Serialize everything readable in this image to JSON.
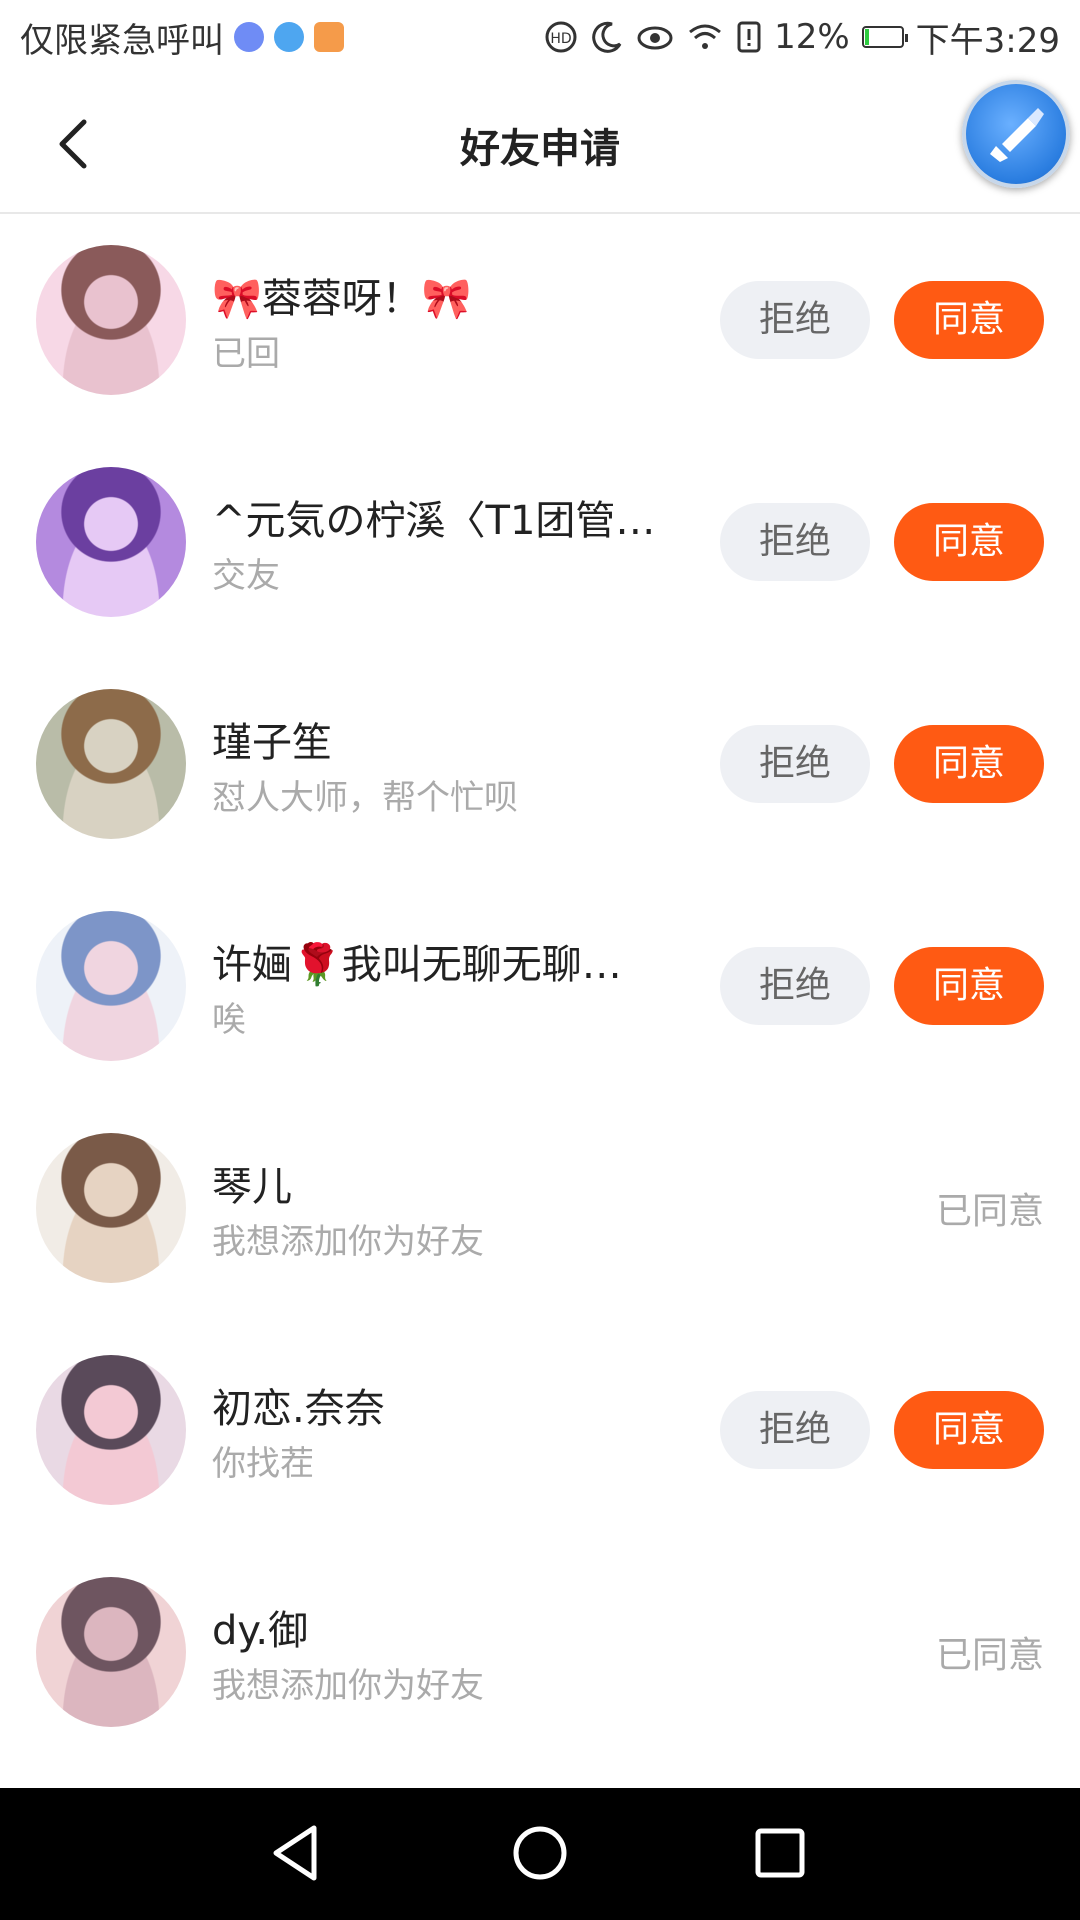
{
  "status_bar": {
    "carrier": "仅限紧急呼叫",
    "battery_pct": "12%",
    "battery_level": 0.12,
    "time": "下午3:29"
  },
  "header": {
    "title": "好友申请"
  },
  "colors": {
    "accent": "#ff5a13",
    "reject_bg": "#eef0f4",
    "muted_text": "#aaaaaa"
  },
  "requests": [
    {
      "name": "🎀蓉蓉呀！🎀",
      "message": "已回",
      "state": "pending",
      "reject_label": "拒绝",
      "agree_label": "同意",
      "avatar_colors": [
        "#f7d8e6",
        "#8a5a5a",
        "#e9c2cf"
      ]
    },
    {
      "name": "^元気の柠溪〈T1团管…",
      "message": "交友",
      "state": "pending",
      "reject_label": "拒绝",
      "agree_label": "同意",
      "avatar_colors": [
        "#b48adf",
        "#6b3fa0",
        "#e6c9f5"
      ]
    },
    {
      "name": "瑾子笙",
      "message": "怼人大师，帮个忙呗",
      "state": "pending",
      "reject_label": "拒绝",
      "agree_label": "同意",
      "avatar_colors": [
        "#b9bca8",
        "#8d6b4a",
        "#d8d2c2"
      ]
    },
    {
      "name": "许婳🌹我叫无聊无聊…",
      "message": "唉",
      "state": "pending",
      "reject_label": "拒绝",
      "agree_label": "同意",
      "avatar_colors": [
        "#eef2f8",
        "#7d95c8",
        "#f0d5e0"
      ]
    },
    {
      "name": "琴儿",
      "message": "我想添加你为好友",
      "state": "accepted",
      "agreed_label": "已同意",
      "avatar_colors": [
        "#f1ece6",
        "#7a5a48",
        "#e6d3c2"
      ]
    },
    {
      "name": "初恋.奈奈",
      "message": "你找茬",
      "state": "pending",
      "reject_label": "拒绝",
      "agree_label": "同意",
      "avatar_colors": [
        "#e9d9e4",
        "#5a4a5a",
        "#f3c9d4"
      ]
    },
    {
      "name": "dy.御",
      "message": "我想添加你为好友",
      "state": "accepted",
      "agreed_label": "已同意",
      "avatar_colors": [
        "#f0d3d5",
        "#6e5560",
        "#dcb6bf"
      ]
    }
  ]
}
